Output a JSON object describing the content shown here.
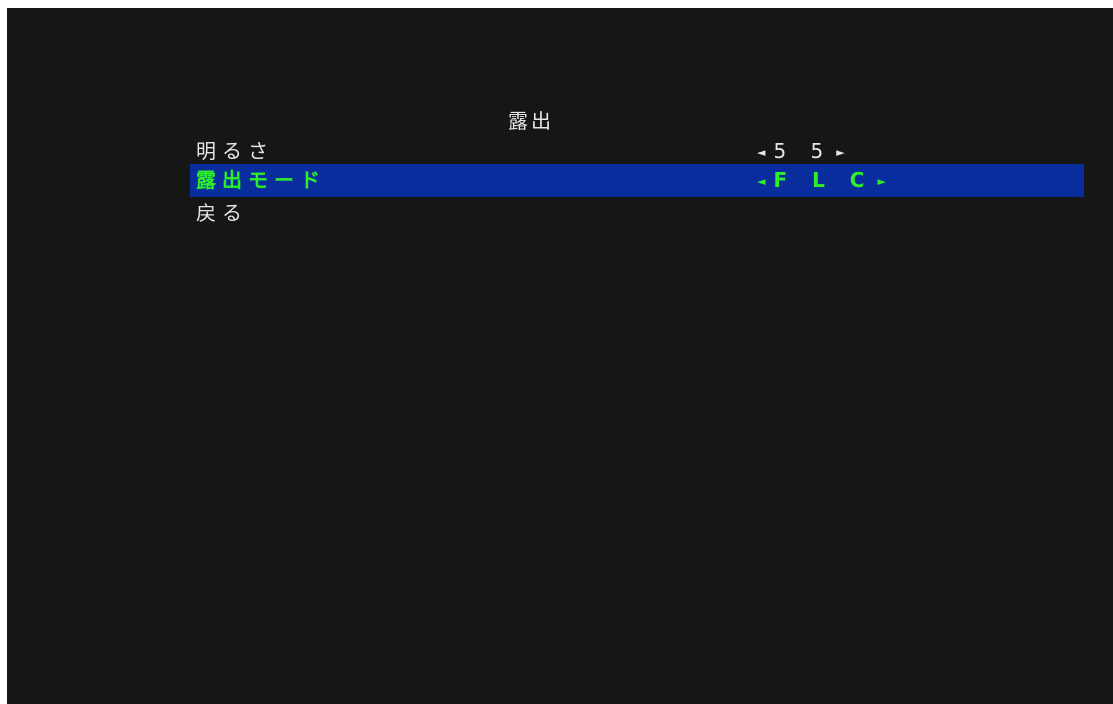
{
  "menu": {
    "title": "露出",
    "items": [
      {
        "label": "明るさ",
        "value": "5 5",
        "left_arrow": "◄",
        "right_arrow": "►",
        "selected": false
      },
      {
        "label": "露出モード",
        "value": "F L C",
        "left_arrow": "◄",
        "right_arrow": "►",
        "selected": true
      },
      {
        "label": "戻る"
      }
    ]
  },
  "colors": {
    "background": "#161616",
    "text": "#e6e6e6",
    "highlight_bar": "#0a2d9e",
    "highlight_text": "#2cf02a"
  }
}
